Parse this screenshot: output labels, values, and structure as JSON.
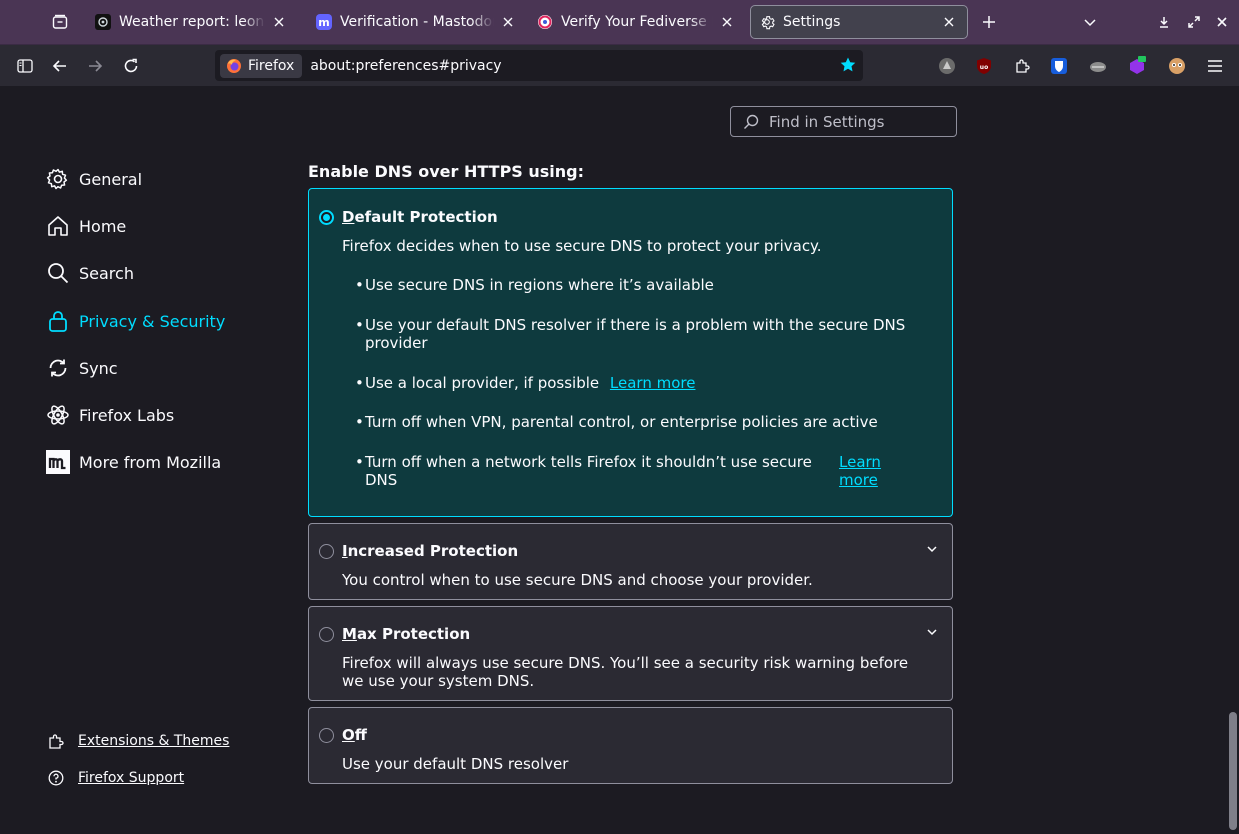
{
  "tabs": [
    {
      "title": "Weather report: leonsbe",
      "favicon": "weather-favicon-icon"
    },
    {
      "title": "Verification - Mastodon",
      "favicon": "mastodon-favicon-icon"
    },
    {
      "title": "Verify Your Fediverse Ide",
      "favicon": "fediverse-favicon-icon"
    },
    {
      "title": "Settings",
      "favicon": "gear-icon",
      "active": true
    }
  ],
  "urlbar": {
    "identity_label": "Firefox",
    "url": "about:preferences#privacy"
  },
  "search": {
    "placeholder": "Find in Settings"
  },
  "sidebar": {
    "items": [
      {
        "label": "General",
        "icon": "gear-icon"
      },
      {
        "label": "Home",
        "icon": "home-icon"
      },
      {
        "label": "Search",
        "icon": "search-icon"
      },
      {
        "label": "Privacy & Security",
        "icon": "lock-icon",
        "selected": true
      },
      {
        "label": "Sync",
        "icon": "sync-icon"
      },
      {
        "label": "Firefox Labs",
        "icon": "labs-icon"
      },
      {
        "label": "More from Mozilla",
        "icon": "mozilla-icon"
      }
    ],
    "footer": [
      {
        "label": "Extensions & Themes",
        "icon": "puzzle-icon"
      },
      {
        "label": "Firefox Support",
        "icon": "help-icon"
      }
    ]
  },
  "dns": {
    "heading": "Enable DNS over HTTPS using:",
    "options": [
      {
        "key": "D",
        "title_rest": "efault Protection",
        "description": "Firefox decides when to use secure DNS to protect your privacy.",
        "selected": true,
        "bullets": [
          "Use secure DNS in regions where it’s available",
          "Use your default DNS resolver if there is a problem with the secure DNS provider",
          "Use a local provider, if possible",
          "Turn off when VPN, parental control, or enterprise policies are active",
          "Turn off when a network tells Firefox it shouldn’t use secure DNS"
        ],
        "learn_more": "Learn more"
      },
      {
        "key": "I",
        "title_rest": "ncreased Protection",
        "description": "You control when to use secure DNS and choose your provider."
      },
      {
        "key": "M",
        "title_rest": "ax Protection",
        "description": "Firefox will always use secure DNS. You’ll see a security risk warning before we use your system DNS."
      },
      {
        "key": "O",
        "title_rest": "ff",
        "description": "Use your default DNS resolver"
      }
    ]
  },
  "colors": {
    "accent": "#00ddff",
    "tabstrip": "#4a3554",
    "selected_card": "#0e3a3e"
  }
}
